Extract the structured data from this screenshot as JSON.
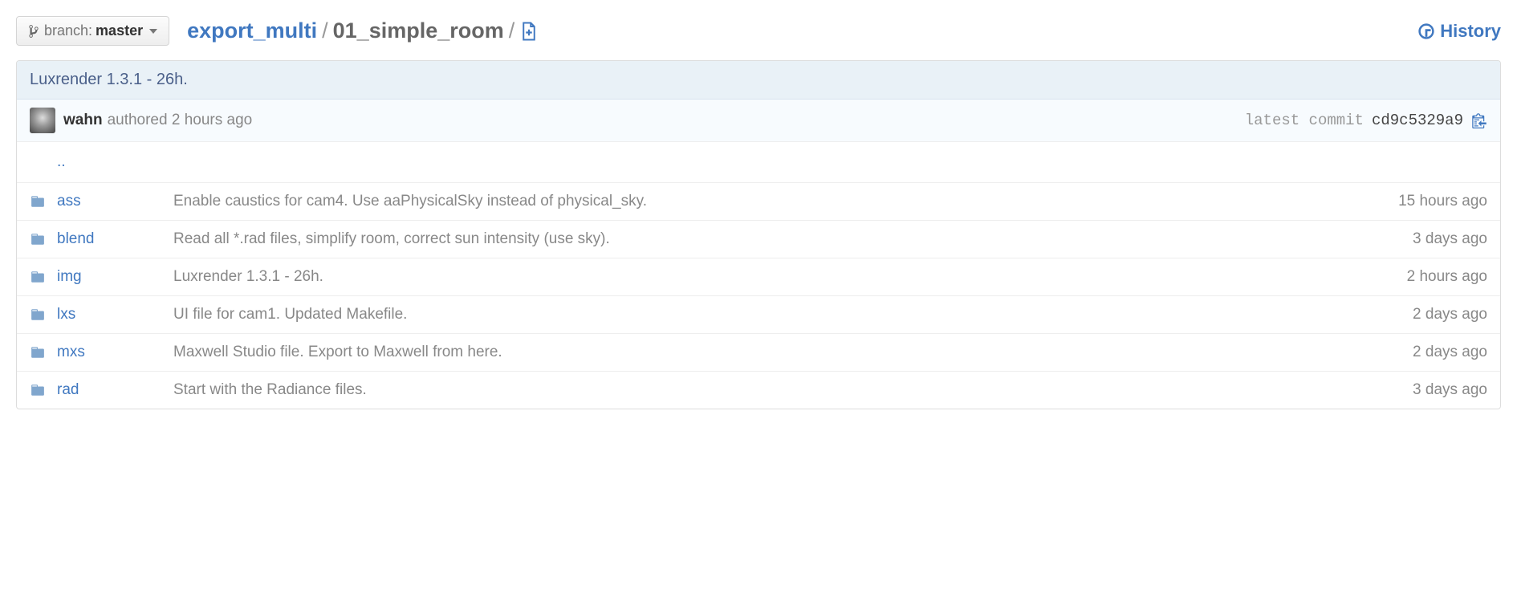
{
  "branch": {
    "label": "branch:",
    "name": "master"
  },
  "breadcrumb": {
    "root": "export_multi",
    "current": "01_simple_room"
  },
  "history_label": "History",
  "commit": {
    "message": "Luxrender 1.3.1 - 26h.",
    "author": "wahn",
    "authored_text": "authored 2 hours ago",
    "latest_commit_label": "latest commit",
    "sha": "cd9c5329a9"
  },
  "parent_dir": "..",
  "files": [
    {
      "name": "ass",
      "message": "Enable caustics for cam4. Use aaPhysicalSky instead of physical_sky.",
      "age": "15 hours ago"
    },
    {
      "name": "blend",
      "message": "Read all *.rad files, simplify room, correct sun intensity (use sky).",
      "age": "3 days ago"
    },
    {
      "name": "img",
      "message": "Luxrender 1.3.1 - 26h.",
      "age": "2 hours ago"
    },
    {
      "name": "lxs",
      "message": "UI file for cam1. Updated Makefile.",
      "age": "2 days ago"
    },
    {
      "name": "mxs",
      "message": "Maxwell Studio file. Export to Maxwell from here.",
      "age": "2 days ago"
    },
    {
      "name": "rad",
      "message": "Start with the Radiance files.",
      "age": "3 days ago"
    }
  ]
}
